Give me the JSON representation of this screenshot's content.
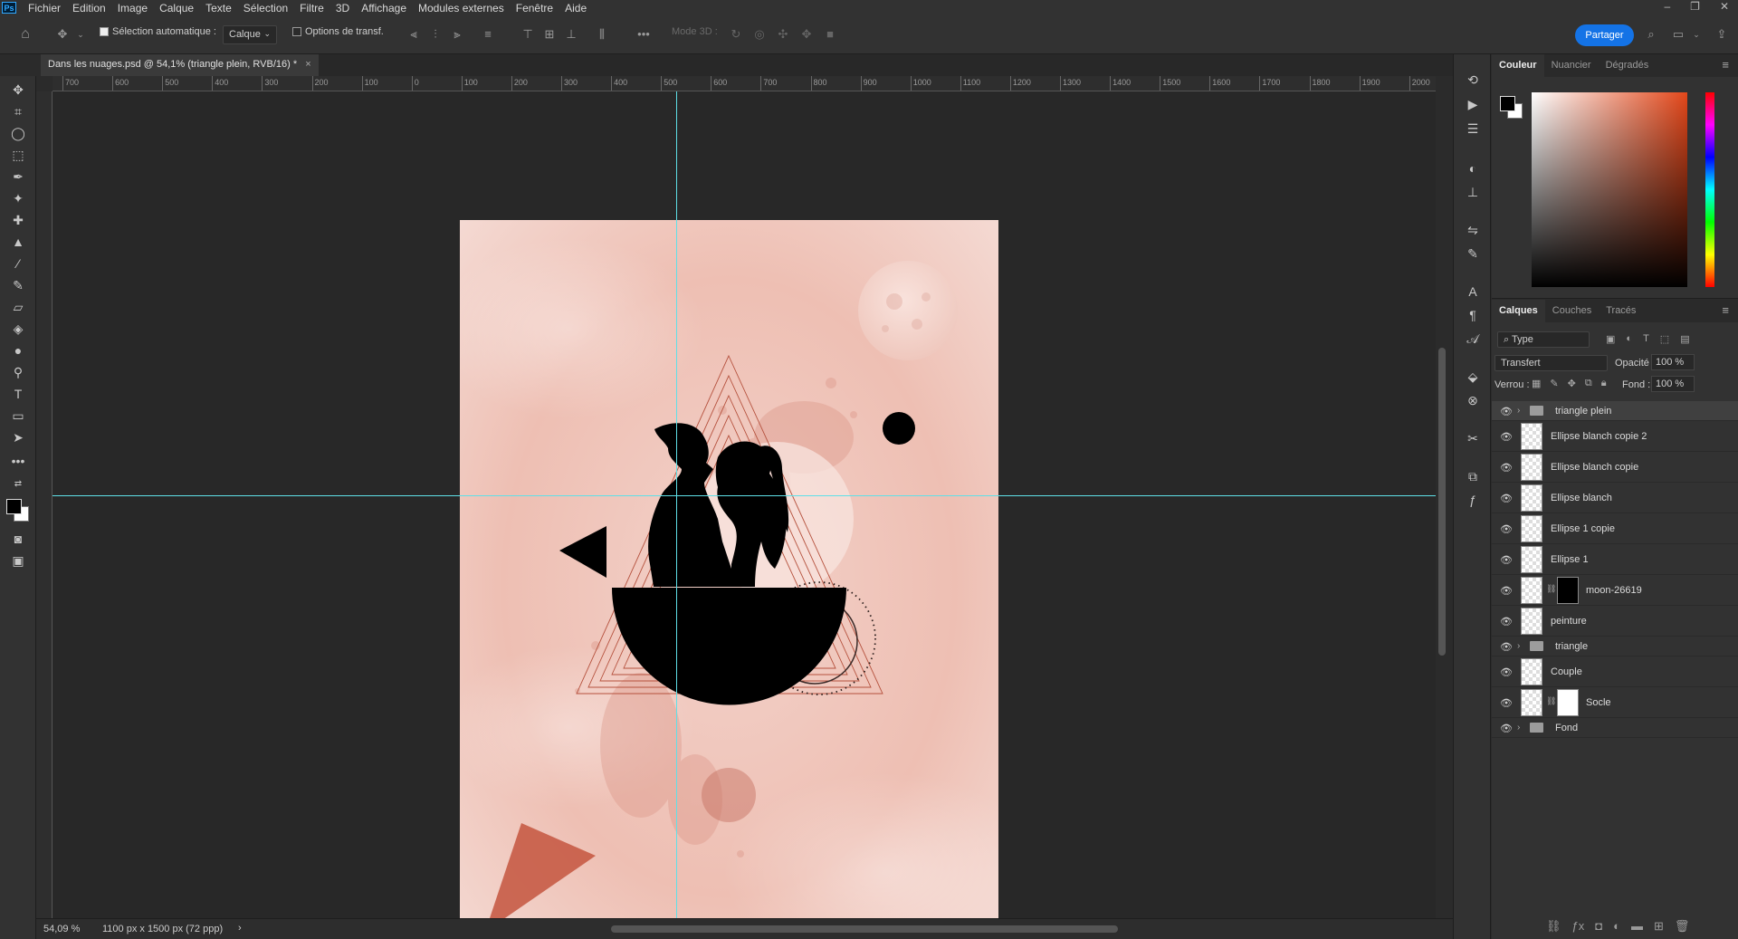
{
  "menu": {
    "logo": "Ps",
    "items": [
      "Fichier",
      "Edition",
      "Image",
      "Calque",
      "Texte",
      "Sélection",
      "Filtre",
      "3D",
      "Affichage",
      "Modules externes",
      "Fenêtre",
      "Aide"
    ],
    "window_controls": [
      "–",
      "❐",
      "✕"
    ]
  },
  "options": {
    "auto_select_label": "Sélection automatique :",
    "auto_select_value": "Calque",
    "transform_label": "Options de transf.",
    "mode3d_label": "Mode 3D :",
    "share": "Partager"
  },
  "tab": {
    "title": "Dans les nuages.psd @ 54,1% (triangle plein, RVB/16) *",
    "close": "×"
  },
  "ruler_top": [
    "700",
    "600",
    "500",
    "400",
    "300",
    "200",
    "100",
    "0",
    "100",
    "200",
    "300",
    "400",
    "500",
    "600",
    "700",
    "800",
    "900",
    "1000",
    "1100",
    "1200",
    "1300",
    "1400",
    "1500",
    "1600",
    "1700",
    "1800",
    "1900",
    "2000"
  ],
  "status": {
    "zoom": "54,09 %",
    "doc_size": "1100 px x 1500 px (72 ppp)",
    "arrow": "›"
  },
  "panels": {
    "color_tabs": [
      "Couleur",
      "Nuancier",
      "Dégradés"
    ],
    "layers_tabs": [
      "Calques",
      "Couches",
      "Tracés"
    ],
    "filter_value": "Type",
    "blend_mode": "Transfert",
    "opacity_label": "Opacité :",
    "opacity_value": "100 %",
    "lock_label": "Verrou :",
    "fill_label": "Fond :",
    "fill_value": "100 %"
  },
  "layers": [
    {
      "name": "triangle plein",
      "kind": "group"
    },
    {
      "name": "Ellipse blanch copie 2",
      "kind": "layer"
    },
    {
      "name": "Ellipse blanch copie",
      "kind": "layer"
    },
    {
      "name": "Ellipse blanch",
      "kind": "layer"
    },
    {
      "name": "Ellipse 1 copie",
      "kind": "layer"
    },
    {
      "name": "Ellipse 1",
      "kind": "layer"
    },
    {
      "name": "moon-26619",
      "kind": "masked"
    },
    {
      "name": "peinture",
      "kind": "layer"
    },
    {
      "name": "triangle",
      "kind": "group"
    },
    {
      "name": "Couple",
      "kind": "layer"
    },
    {
      "name": "Socle",
      "kind": "masked"
    },
    {
      "name": "Fond",
      "kind": "group"
    }
  ],
  "colors": {
    "accent": "#1473e6",
    "guide": "#5ee0e8",
    "artboard": "#f2c9bf"
  }
}
